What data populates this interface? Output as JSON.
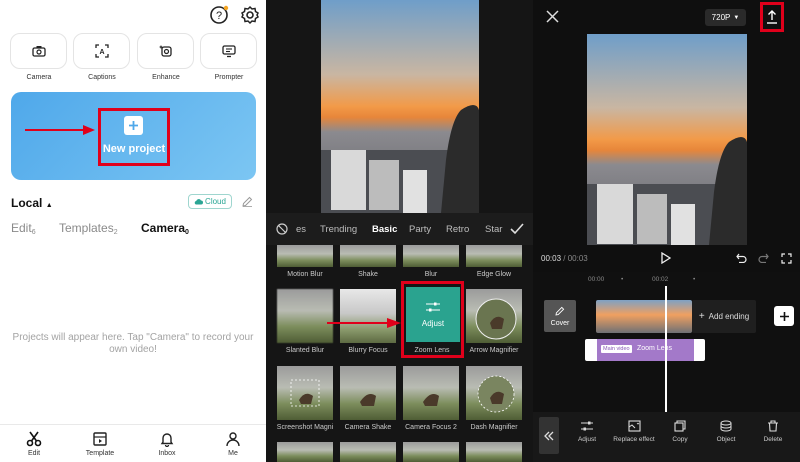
{
  "left": {
    "tools": [
      {
        "label": "Camera",
        "icon": "camera-icon"
      },
      {
        "label": "Captions",
        "icon": "captions-icon"
      },
      {
        "label": "Enhance",
        "icon": "enhance-icon"
      },
      {
        "label": "Prompter",
        "icon": "prompter-icon"
      }
    ],
    "new_project": "New project",
    "local_title": "Local",
    "cloud": "Cloud",
    "tabs": [
      {
        "label": "Edit",
        "count": "6"
      },
      {
        "label": "Templates",
        "count": "2"
      },
      {
        "label": "Camera",
        "count": "0"
      }
    ],
    "empty_message": "Projects will appear here. Tap \"Camera\" to record your own video!",
    "nav": [
      {
        "label": "Edit",
        "icon": "scissors-icon"
      },
      {
        "label": "Template",
        "icon": "template-icon"
      },
      {
        "label": "Inbox",
        "icon": "bell-icon"
      },
      {
        "label": "Me",
        "icon": "person-icon"
      }
    ]
  },
  "middle": {
    "filter_tabs": [
      "es",
      "Trending",
      "Basic",
      "Party",
      "Retro",
      "Star"
    ],
    "active_tab": "Basic",
    "row0": [
      "Motion Blur",
      "Shake",
      "Blur",
      "Edge Glow"
    ],
    "row1": [
      "Slanted Blur",
      "Blurry Focus",
      "Zoom Lens",
      "Arrow Magnifier"
    ],
    "row2": [
      "Screenshot Magni",
      "Camera Shake",
      "Camera Focus 2",
      "Dash Magnifier"
    ],
    "adjust": "Adjust"
  },
  "right": {
    "resolution": "720P",
    "time_current": "00:03",
    "time_total": "00:03",
    "ticks": [
      "00:00",
      "00:02"
    ],
    "cover": "Cover",
    "add_ending": "Add ending",
    "fx_tag": "Main video",
    "fx_name": "Zoom Lens",
    "toolbar": [
      {
        "label": "Adjust",
        "icon": "sliders-icon"
      },
      {
        "label": "Replace effect",
        "icon": "replace-icon"
      },
      {
        "label": "Copy",
        "icon": "copy-icon"
      },
      {
        "label": "Object",
        "icon": "object-icon"
      },
      {
        "label": "Delete",
        "icon": "trash-icon"
      }
    ]
  },
  "colors": {
    "accent_red": "#e0001b",
    "teal": "#2aa38f",
    "purple": "#a379c9",
    "hero_blue": "#5aaeec"
  }
}
